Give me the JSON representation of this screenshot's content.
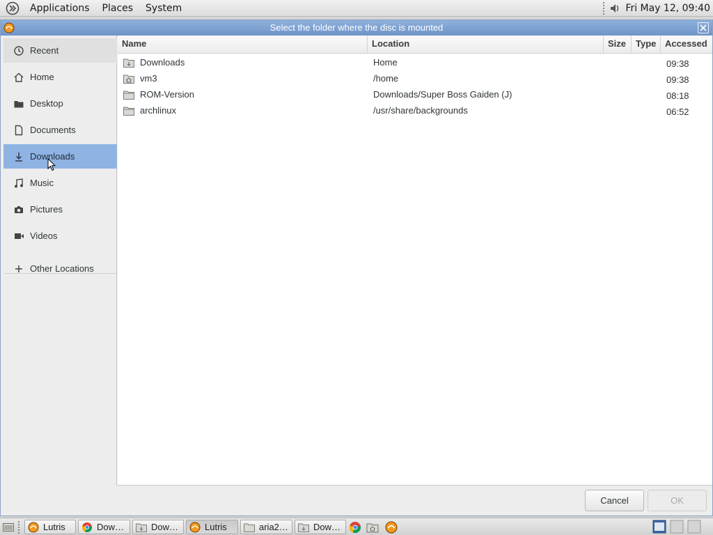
{
  "top_panel": {
    "menus": [
      "Applications",
      "Places",
      "System"
    ],
    "clock": "Fri May 12, 09:40"
  },
  "dialog": {
    "title": "Select the folder where the disc is mounted",
    "sidebar": {
      "items": [
        {
          "label": "Recent",
          "icon": "recent-icon"
        },
        {
          "label": "Home",
          "icon": "home-icon"
        },
        {
          "label": "Desktop",
          "icon": "desktop-icon"
        },
        {
          "label": "Documents",
          "icon": "documents-icon"
        },
        {
          "label": "Downloads",
          "icon": "downloads-icon",
          "selected": true
        },
        {
          "label": "Music",
          "icon": "music-icon"
        },
        {
          "label": "Pictures",
          "icon": "pictures-icon"
        },
        {
          "label": "Videos",
          "icon": "videos-icon"
        }
      ],
      "other_locations": "Other Locations"
    },
    "columns": {
      "name": "Name",
      "location": "Location",
      "size": "Size",
      "type": "Type",
      "accessed": "Accessed"
    },
    "rows": [
      {
        "name": "Downloads",
        "location": "Home",
        "size": "",
        "type": "",
        "accessed": "09:38",
        "icon": "downloads-folder-icon"
      },
      {
        "name": "vm3",
        "location": "/home",
        "size": "",
        "type": "",
        "accessed": "09:38",
        "icon": "home-folder-icon"
      },
      {
        "name": "ROM-Version",
        "location": "Downloads/Super Boss Gaiden (J)",
        "size": "",
        "type": "",
        "accessed": "08:18",
        "icon": "folder-icon"
      },
      {
        "name": "archlinux",
        "location": "/usr/share/backgrounds",
        "size": "",
        "type": "",
        "accessed": "06:52",
        "icon": "folder-icon"
      }
    ],
    "buttons": {
      "cancel": "Cancel",
      "ok": "OK"
    }
  },
  "taskbar": {
    "tasks": [
      {
        "label": "Lutris",
        "icon": "lutris-icon"
      },
      {
        "label": "Dow…",
        "icon": "chrome-icon"
      },
      {
        "label": "Dow…",
        "icon": "file-manager-icon"
      },
      {
        "label": "Lutris",
        "icon": "lutris-icon",
        "active": true
      },
      {
        "label": "aria2…",
        "icon": "folder-icon"
      },
      {
        "label": "Dow…",
        "icon": "file-manager-icon"
      }
    ]
  },
  "colors": {
    "titlebar": "#7ea1d2",
    "selection": "#8fb3e3",
    "folder": "#8c8c84"
  }
}
